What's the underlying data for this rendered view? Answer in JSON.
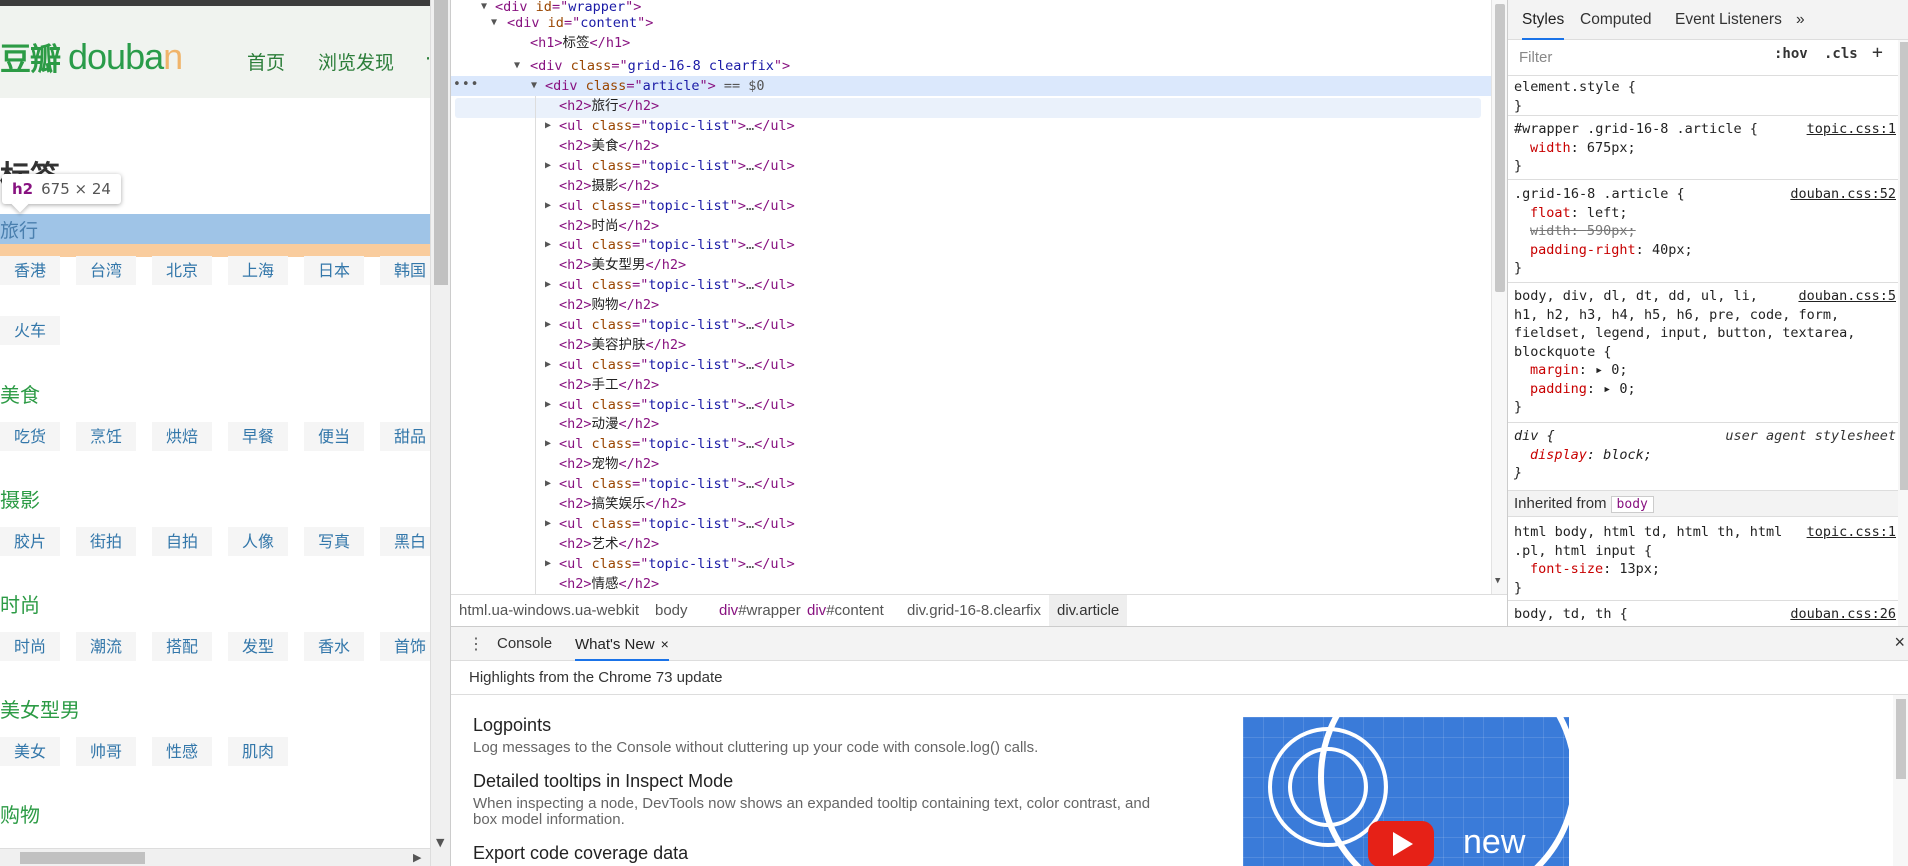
{
  "page": {
    "logo_cn": "豆瓣",
    "logo_en_main": "douba",
    "logo_en_tail": "n",
    "nav": [
      "首页",
      "浏览发现"
    ],
    "nav_more": "·",
    "h1": "标签",
    "tooltip": {
      "tag": "h2",
      "dims": "675 × 24"
    },
    "selected_h2": "旅行",
    "sections": [
      {
        "title": "美食",
        "tags": [
          "吃货",
          "烹饪",
          "烘焙",
          "早餐",
          "便当",
          "甜品"
        ]
      },
      {
        "title": "摄影",
        "tags": [
          "胶片",
          "街拍",
          "自拍",
          "人像",
          "写真",
          "黑白"
        ]
      },
      {
        "title": "时尚",
        "tags": [
          "时尚",
          "潮流",
          "搭配",
          "发型",
          "香水",
          "首饰"
        ]
      },
      {
        "title": "美女型男",
        "tags": [
          "美女",
          "帅哥",
          "性感",
          "肌肉"
        ]
      },
      {
        "title": "购物",
        "tags": []
      }
    ],
    "travel_tags": [
      "香港",
      "台湾",
      "北京",
      "上海",
      "日本",
      "韩国"
    ],
    "travel_tags_row2": [
      "火车"
    ]
  },
  "devtools": {
    "tree": {
      "wrapper": {
        "tag": "div",
        "attr": "id",
        "val": "wrapper"
      },
      "content": {
        "tag": "div",
        "attr": "id",
        "val": "content"
      },
      "h1": {
        "tag": "h1",
        "text": "标签"
      },
      "grid": {
        "tag": "div",
        "attr": "class",
        "val": "grid-16-8 clearfix"
      },
      "article": {
        "tag": "div",
        "attr": "class",
        "val": "article",
        "suffix": " == $0"
      },
      "h2_first": "旅行",
      "ul_class": "topic-list",
      "ellipsis": "…",
      "h2_items": [
        "美食",
        "摄影",
        "时尚",
        "美女型男",
        "购物",
        "美容护肤",
        "手工",
        "动漫",
        "宠物",
        "搞笑娱乐",
        "艺术",
        "情感"
      ]
    },
    "breadcrumbs": [
      {
        "label": "html.ua-windows.ua-webkit",
        "tag": ""
      },
      {
        "label": "body",
        "tag": ""
      },
      {
        "label": "#wrapper",
        "tag": "div"
      },
      {
        "label": "#content",
        "tag": "div"
      },
      {
        "label": "div.grid-16-8.clearfix",
        "tag": ""
      },
      {
        "label": "div.article",
        "tag": ""
      }
    ],
    "styles_tabs": [
      "Styles",
      "Computed",
      "Event Listeners",
      "»"
    ],
    "filter_placeholder": "Filter",
    "hov": ":hov",
    "cls": ".cls",
    "plus": "+",
    "rules": {
      "element_style": "element.style {",
      "r1": {
        "selector": "#wrapper .grid-16-8 .article {",
        "source": "topic.css:1",
        "props": [
          [
            "width",
            "675px;"
          ]
        ]
      },
      "r2": {
        "selector": ".grid-16-8 .article {",
        "source": "douban.css:52",
        "props": [
          [
            "float",
            "left;"
          ],
          [
            "width",
            "590px;"
          ],
          [
            "padding-right",
            "40px;"
          ]
        ]
      },
      "r3": {
        "selector_lines": [
          "body, div, dl, dt, dd, ul, li,",
          "h1, h2, h3, h4, h5, h6, pre, code, form,",
          "fieldset, legend, input, button, textarea,",
          "blockquote {"
        ],
        "source": "douban.css:5",
        "props": [
          [
            "margin",
            "0;"
          ],
          [
            "padding",
            "0;"
          ]
        ]
      },
      "r4": {
        "selector": "div {",
        "source": "user agent stylesheet",
        "props": [
          [
            "display",
            "block;"
          ]
        ]
      },
      "inherited_label": "Inherited from",
      "inherited_chip": "body",
      "r5": {
        "selector_lines": [
          "html body, html td, html th, html",
          ".pl, html input {"
        ],
        "source": "topic.css:1",
        "props": [
          [
            "font-size",
            "13px;"
          ]
        ]
      },
      "r6": {
        "selector": "body, td, th {",
        "source": "douban.css:26"
      },
      "close_brace": "}"
    },
    "drawer": {
      "tabs": [
        "Console",
        "What's New"
      ],
      "close_tab": "×",
      "close_drawer": "×",
      "kebab": "⋮",
      "subhead": "Highlights from the Chrome 73 update",
      "features": [
        {
          "title": "Logpoints",
          "desc": "Log messages to the Console without cluttering up your code with console.log() calls."
        },
        {
          "title": "Detailed tooltips in Inspect Mode",
          "desc": "When inspecting a node, DevTools now shows an expanded tooltip containing text, color contrast, and box model information."
        },
        {
          "title": "Export code coverage data",
          "desc": ""
        }
      ],
      "banner_text": "new"
    }
  }
}
